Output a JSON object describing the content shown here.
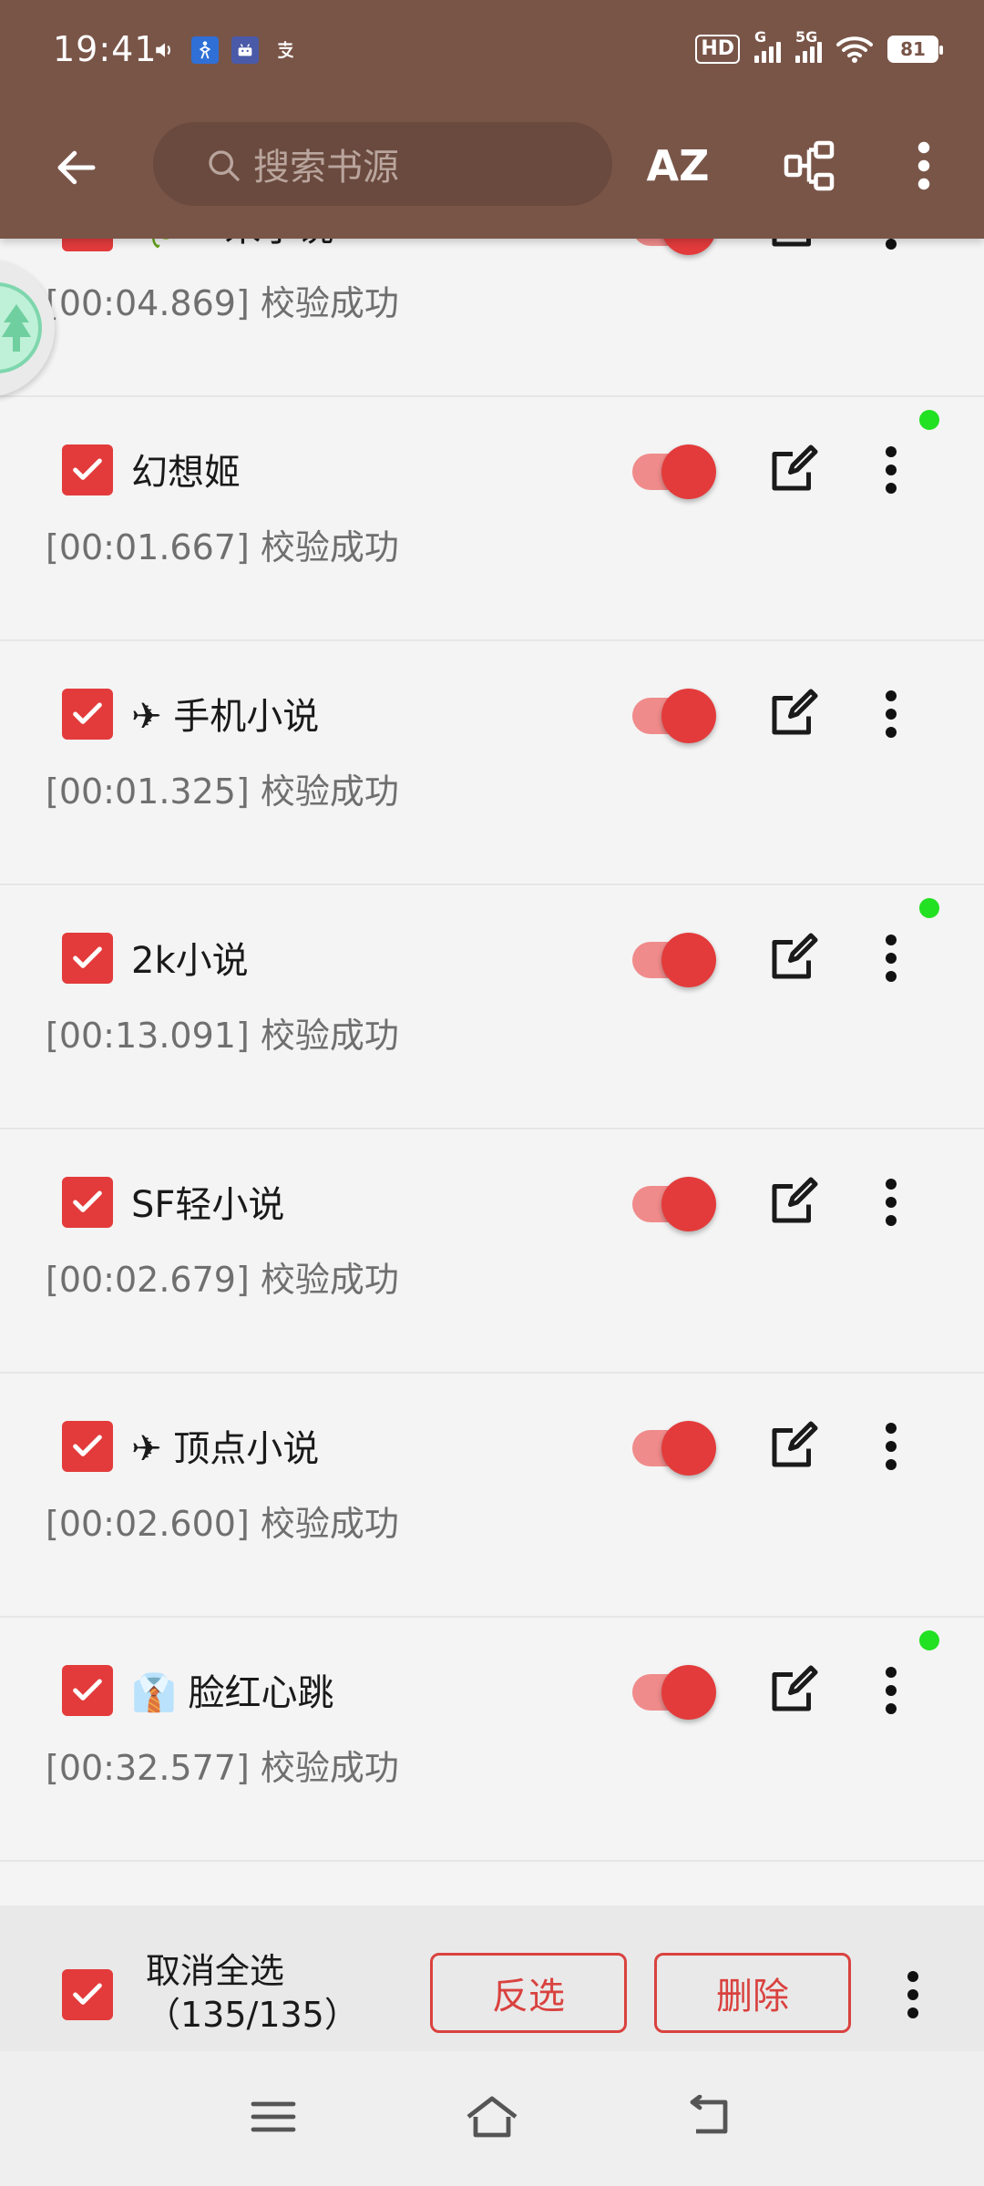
{
  "status_bar": {
    "time": "19:41",
    "hd_label": "HD",
    "signal_label_1": "G",
    "signal_label_2": "5G",
    "battery": "81",
    "left_icons": [
      "volume-icon",
      "accessibility-icon",
      "android-icon",
      "alipay-icon"
    ]
  },
  "toolbar": {
    "search_placeholder": "搜索书源",
    "sort_label": "AZ"
  },
  "sources": [
    {
      "icon": "☘️",
      "name": "一米小说",
      "status": "[00:04.869] 校验成功",
      "enabled": true,
      "checked": true,
      "online": true
    },
    {
      "icon": "",
      "name": "幻想姬",
      "status": "[00:01.667] 校验成功",
      "enabled": true,
      "checked": true,
      "online": true
    },
    {
      "icon": "✈",
      "name": "手机小说",
      "status": "[00:01.325] 校验成功",
      "enabled": true,
      "checked": true,
      "online": false
    },
    {
      "icon": "",
      "name": "2k小说",
      "status": "[00:13.091] 校验成功",
      "enabled": true,
      "checked": true,
      "online": true
    },
    {
      "icon": "",
      "name": "SF轻小说",
      "status": "[00:02.679] 校验成功",
      "enabled": true,
      "checked": true,
      "online": false
    },
    {
      "icon": "✈",
      "name": "顶点小说",
      "status": "[00:02.600] 校验成功",
      "enabled": true,
      "checked": true,
      "online": false
    },
    {
      "icon": "👔",
      "name": "脸红心跳",
      "status": "[00:32.577] 校验成功",
      "enabled": true,
      "checked": true,
      "online": true
    }
  ],
  "bottom_bar": {
    "select_label": "取消全选",
    "count": "（135/135）",
    "invert_label": "反选",
    "delete_label": "删除"
  },
  "colors": {
    "header": "#795548",
    "accent": "#e33b3b",
    "online_dot": "#22e022"
  }
}
